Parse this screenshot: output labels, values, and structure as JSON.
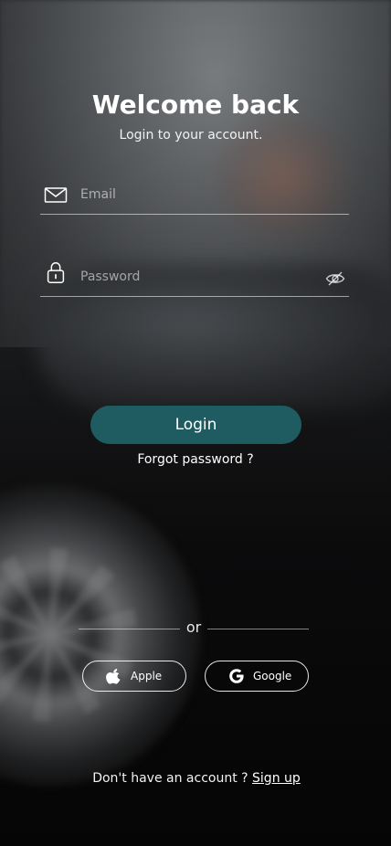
{
  "header": {
    "title": "Welcome back",
    "subtitle": "Login to your account."
  },
  "form": {
    "email": {
      "placeholder": "Email",
      "value": ""
    },
    "password": {
      "placeholder": "Password",
      "value": ""
    },
    "login_label": "Login",
    "forgot_label": "Forgot password ?"
  },
  "divider": {
    "label": "or"
  },
  "social": {
    "apple_label": "Apple",
    "google_label": "Google"
  },
  "footer": {
    "prompt": "Don't have an account ?",
    "signup_label": "Sign up"
  },
  "icons": {
    "email": "envelope-icon",
    "password": "lock-icon",
    "visibility": "eye-slash-icon",
    "apple": "apple-icon",
    "google": "google-icon"
  },
  "colors": {
    "primary_button": "#1f5c62",
    "text": "#ffffff"
  }
}
